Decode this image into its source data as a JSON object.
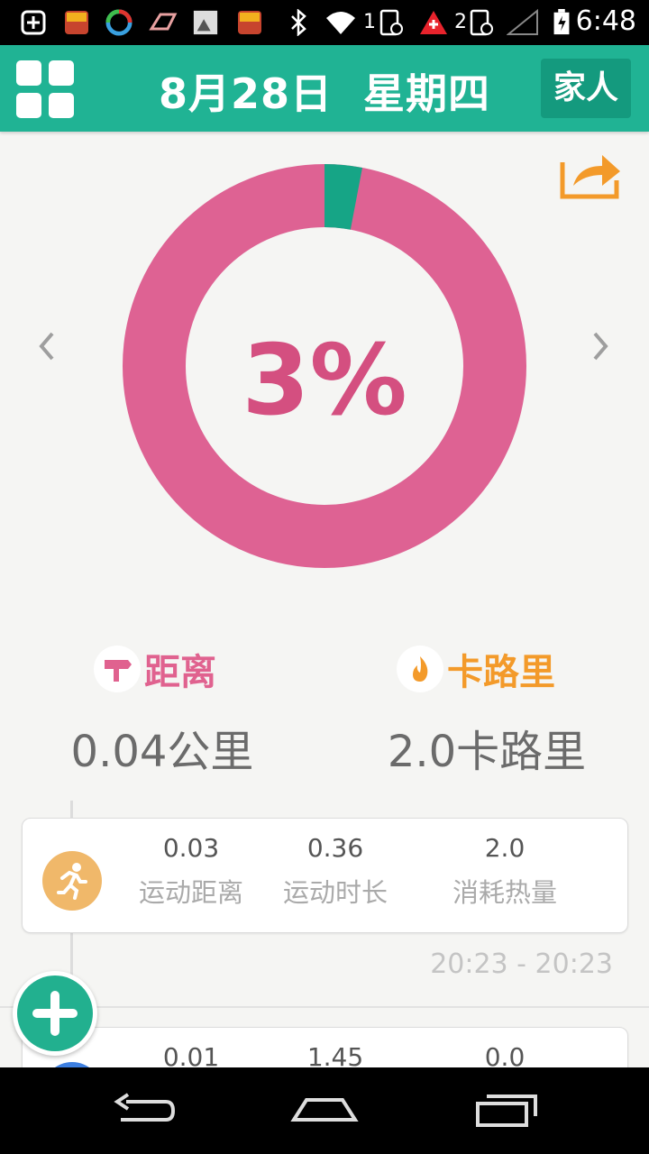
{
  "status_bar": {
    "time": "6:48",
    "sim1_label": "1",
    "sim2_label": "2",
    "notif_icons": [
      "add-icon",
      "app-icon",
      "sync-icon",
      "car-icon",
      "image-icon",
      "app-icon"
    ]
  },
  "header": {
    "date": "8月28日",
    "weekday": "星期四",
    "family_label": "家人"
  },
  "progress": {
    "percent_text": "3%",
    "percent_value": 0.03,
    "done_color": "#16a586",
    "remaining_color": "#de6293"
  },
  "stats": {
    "distance_label": "距离",
    "distance_value": "0.04公里",
    "calorie_label": "卡路里",
    "calorie_value": "2.0卡路里",
    "distance_color": "#e0628f",
    "calorie_color": "#f39a2a"
  },
  "activities": [
    {
      "icon": "running-icon",
      "values": [
        "0.03",
        "0.36",
        "2.0"
      ],
      "labels": [
        "运动距离",
        "运动时长",
        "消耗热量"
      ],
      "time_range": "20:23 - 20:23"
    },
    {
      "icon": "activity-icon",
      "values": [
        "0.01",
        "1.45",
        "0.0"
      ]
    }
  ]
}
